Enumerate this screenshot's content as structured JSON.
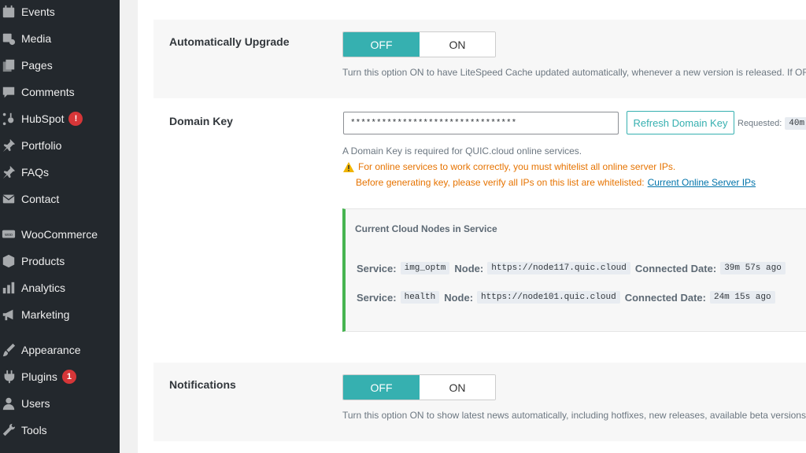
{
  "sidebar": {
    "items": [
      {
        "label": "Events",
        "icon": "calendar-icon"
      },
      {
        "label": "Media",
        "icon": "media-icon"
      },
      {
        "label": "Pages",
        "icon": "pages-icon"
      },
      {
        "label": "Comments",
        "icon": "comments-icon"
      },
      {
        "label": "HubSpot",
        "icon": "hubspot-icon",
        "badge": "!"
      },
      {
        "label": "Portfolio",
        "icon": "pin-icon"
      },
      {
        "label": "FAQs",
        "icon": "pin-icon"
      },
      {
        "label": "Contact",
        "icon": "envelope-icon"
      },
      {
        "label": "WooCommerce",
        "icon": "woo-icon"
      },
      {
        "label": "Products",
        "icon": "box-icon"
      },
      {
        "label": "Analytics",
        "icon": "bar-chart-icon"
      },
      {
        "label": "Marketing",
        "icon": "megaphone-icon"
      },
      {
        "label": "Appearance",
        "icon": "brush-icon"
      },
      {
        "label": "Plugins",
        "icon": "plug-icon",
        "badge": "1"
      },
      {
        "label": "Users",
        "icon": "user-icon"
      },
      {
        "label": "Tools",
        "icon": "wrench-icon"
      }
    ]
  },
  "settings": {
    "auto_upgrade": {
      "label": "Automatically Upgrade",
      "off": "OFF",
      "on": "ON",
      "selected": "OFF",
      "desc": "Turn this option ON to have LiteSpeed Cache updated automatically, whenever a new version is released. If OFF"
    },
    "domain_key": {
      "label": "Domain Key",
      "value": "********************************",
      "refresh": "Refresh Domain Key",
      "requested_label": "Requested:",
      "requested_value": "40m",
      "desc": "A Domain Key is required for QUIC.cloud online services.",
      "warn1": "For online services to work correctly, you must whitelist all online server IPs.",
      "warn2": "Before generating key, please verify all IPs on this list are whitelisted:",
      "warn2_link": "Current Online Server IPs"
    },
    "cloud_nodes": {
      "title": "Current Cloud Nodes in Service",
      "service_key": "Service:",
      "node_key": "Node:",
      "date_key": "Connected Date:",
      "rows": [
        {
          "service": "img_optm",
          "node": "https://node117.quic.cloud",
          "date": "39m 57s ago"
        },
        {
          "service": "health",
          "node": "https://node101.quic.cloud",
          "date": "24m 15s ago"
        }
      ]
    },
    "notifications": {
      "label": "Notifications",
      "off": "OFF",
      "on": "ON",
      "selected": "OFF",
      "desc": "Turn this option ON to show latest news automatically, including hotfixes, new releases, available beta versions,"
    }
  },
  "colors": {
    "sidebar_bg": "#23282d",
    "toggle_active": "#36b0b0",
    "warning": "#e67300",
    "success_border": "#46b450",
    "badge": "#d63638"
  }
}
